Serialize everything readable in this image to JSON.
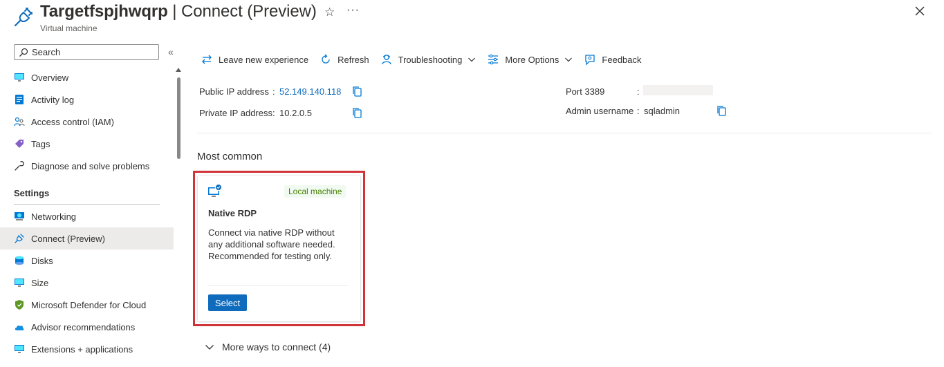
{
  "header": {
    "resource_name": "Targetfspjhwqrp",
    "title_suffix": " | Connect (Preview)",
    "subtitle": "Virtual machine",
    "favorite_icon": "star-icon",
    "more_label": "···",
    "close_icon": "close-icon"
  },
  "sidebar": {
    "search_placeholder": "Search",
    "collapse_label": "«",
    "items_top": [
      {
        "label": "Overview",
        "icon": "monitor-icon"
      },
      {
        "label": "Activity log",
        "icon": "activity-log-icon"
      },
      {
        "label": "Access control (IAM)",
        "icon": "people-icon"
      },
      {
        "label": "Tags",
        "icon": "tag-icon"
      },
      {
        "label": "Diagnose and solve problems",
        "icon": "wrench-icon"
      }
    ],
    "section_title": "Settings",
    "items_settings": [
      {
        "label": "Networking",
        "icon": "network-icon"
      },
      {
        "label": "Connect (Preview)",
        "icon": "plug-icon",
        "active": true
      },
      {
        "label": "Disks",
        "icon": "disks-icon"
      },
      {
        "label": "Size",
        "icon": "monitor-icon"
      },
      {
        "label": "Microsoft Defender for Cloud",
        "icon": "shield-icon"
      },
      {
        "label": "Advisor recommendations",
        "icon": "cloud-icon"
      },
      {
        "label": "Extensions + applications",
        "icon": "extensions-icon"
      }
    ]
  },
  "toolbar": {
    "leave_label": "Leave new experience",
    "refresh_label": "Refresh",
    "troubleshoot_label": "Troubleshooting",
    "more_options_label": "More Options",
    "feedback_label": "Feedback"
  },
  "connection": {
    "public_ip_label": "Public IP address",
    "public_ip_sep": ":",
    "public_ip_value": "52.149.140.118",
    "private_ip_label": "Private IP address",
    "private_ip_sep": ":",
    "private_ip_value": "10.2.0.5",
    "port_label": "Port 3389",
    "port_sep": ":",
    "admin_label": "Admin username",
    "admin_sep": ":",
    "admin_value": "sqladmin"
  },
  "main": {
    "most_common_label": "Most common",
    "card": {
      "badge": "Local machine",
      "title": "Native RDP",
      "description": "Connect via native RDP without any additional software needed. Recommended for testing only.",
      "select_label": "Select"
    },
    "more_ways_label": "More ways to connect (4)"
  },
  "colors": {
    "accent": "#0f6cbd",
    "highlight": "#d13438",
    "badge_bg": "#f1faf1",
    "badge_text": "#498205",
    "active_nav_bg": "#edebe9"
  }
}
